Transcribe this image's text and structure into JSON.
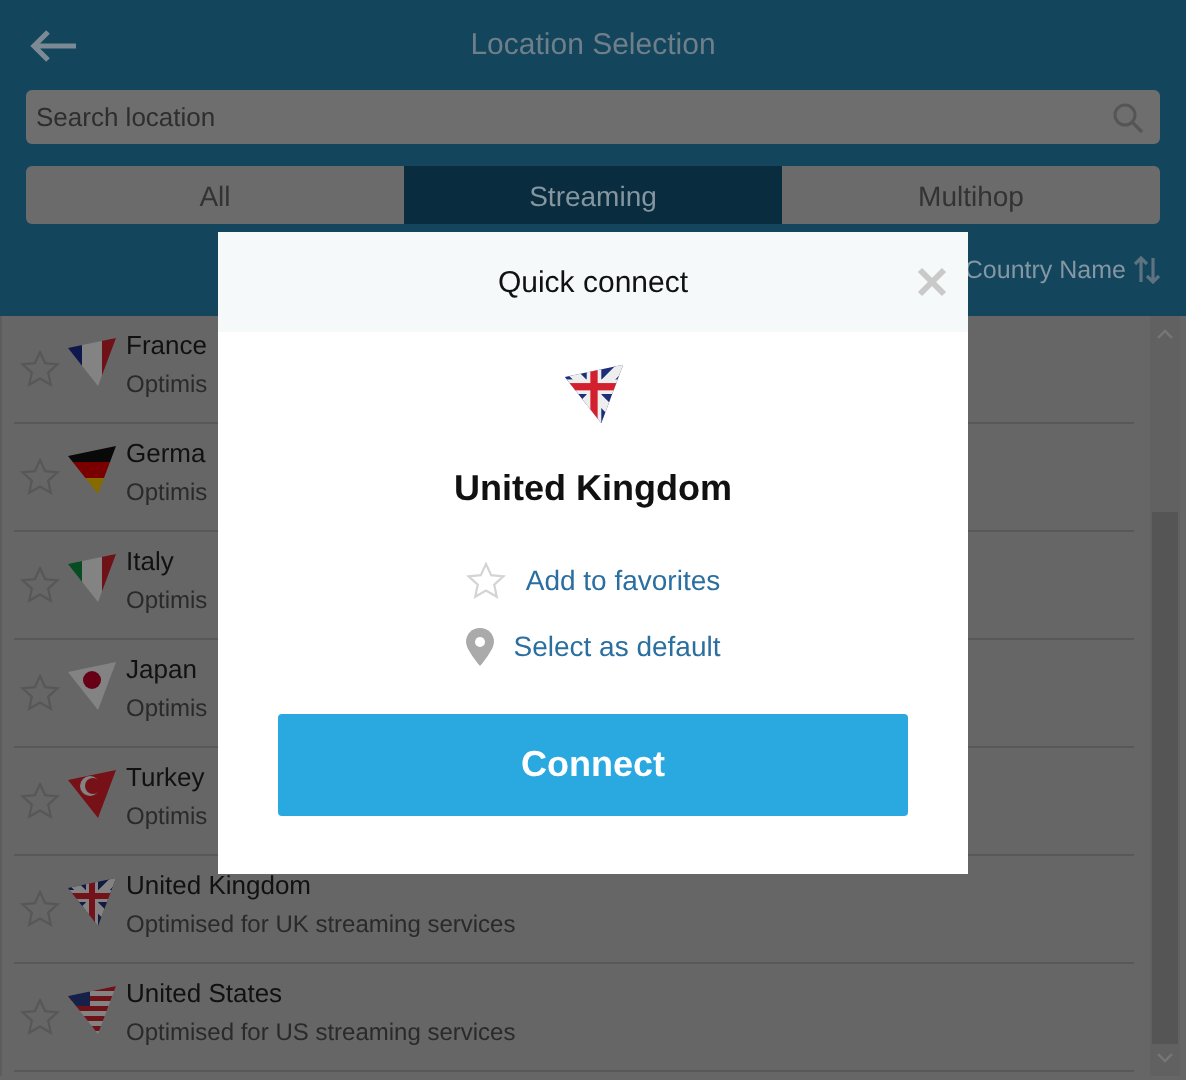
{
  "header": {
    "title": "Location Selection"
  },
  "search": {
    "placeholder": "Search location"
  },
  "tabs": [
    {
      "label": "All",
      "selected": false
    },
    {
      "label": "Streaming",
      "selected": true
    },
    {
      "label": "Multihop",
      "selected": false
    }
  ],
  "sort": {
    "label": "Country Name"
  },
  "locations": [
    {
      "name": "France",
      "subtitle": "Optimis",
      "kind": "france",
      "favorite": false
    },
    {
      "name": "Germa",
      "subtitle": "Optimis",
      "kind": "germany",
      "favorite": false
    },
    {
      "name": "Italy",
      "subtitle": "Optimis",
      "kind": "italy",
      "favorite": false
    },
    {
      "name": "Japan",
      "subtitle": "Optimis",
      "kind": "japan",
      "favorite": false
    },
    {
      "name": "Turkey",
      "subtitle": "Optimis",
      "kind": "turkey",
      "favorite": false
    },
    {
      "name": "United Kingdom",
      "subtitle": "Optimised for UK streaming services",
      "kind": "uk",
      "favorite": false
    },
    {
      "name": "United States",
      "subtitle": "Optimised for US streaming services",
      "kind": "us",
      "favorite": false
    }
  ],
  "dialog": {
    "title": "Quick connect",
    "kind": "uk",
    "country": "United Kingdom",
    "favorite_link": "Add to favorites",
    "default_link": "Select as default",
    "button": "Connect"
  }
}
